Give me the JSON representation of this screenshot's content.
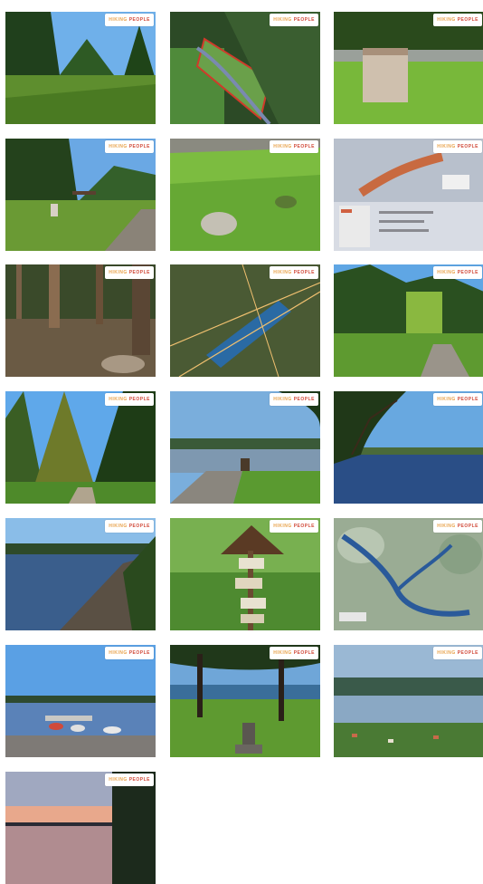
{
  "gallery": {
    "watermark": {
      "left": "HIKING",
      "right": "PEOPLE",
      "colors": [
        "#e8a24a",
        "#d14a3a"
      ]
    },
    "photos": [
      {
        "name": "forest-clearing-meadow"
      },
      {
        "name": "aerial-forest-trail-map"
      },
      {
        "name": "stone-pillar-on-lawn"
      },
      {
        "name": "meadow-with-benches"
      },
      {
        "name": "grass-with-round-stone"
      },
      {
        "name": "information-board-map"
      },
      {
        "name": "forest-floor-trunks"
      },
      {
        "name": "aerial-lake-view"
      },
      {
        "name": "forest-path-hillside"
      },
      {
        "name": "spruce-trees-path"
      },
      {
        "name": "lake-shore-with-village"
      },
      {
        "name": "lake-under-tree-branches"
      },
      {
        "name": "lake-and-gravel-shore"
      },
      {
        "name": "signpost-in-forest"
      },
      {
        "name": "satellite-map-of-lake"
      },
      {
        "name": "boat-pier-with-boats"
      },
      {
        "name": "statue-by-lake"
      },
      {
        "name": "panoramic-lake-view"
      },
      {
        "name": "sunset-over-lake"
      }
    ]
  }
}
